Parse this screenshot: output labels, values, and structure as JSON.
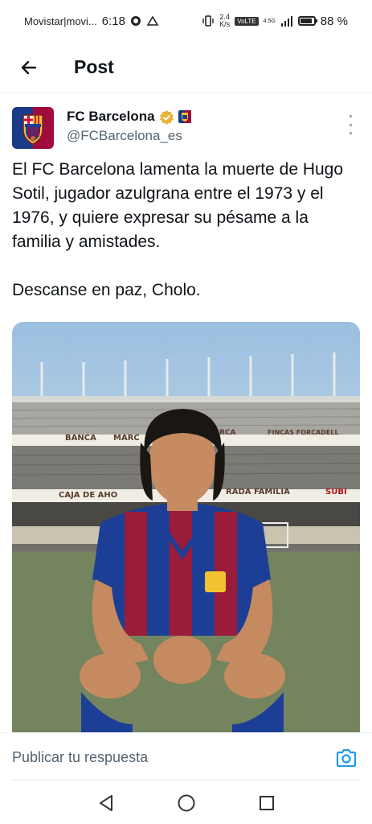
{
  "status_bar": {
    "carrier": "Movistar|movi...",
    "time": "6:18",
    "speed_value": "2.4",
    "speed_unit": "K/s",
    "volte": "VoLTE",
    "network": "4.5G",
    "battery_percent": "88 %",
    "battery_level": 0.88
  },
  "header": {
    "title": "Post"
  },
  "post": {
    "author_name": "FC Barcelona",
    "author_handle": "@FCBarcelona_es",
    "verified_color": "#e8b339",
    "text": "El FC Barcelona lamenta la muerte de Hugo Sotil, jugador azulgrana entre el 1973 y el 1976, y quiere expresar su pésame a la familia y amistades.\n\nDescanse en paz, Cholo.",
    "photo": {
      "banners": [
        "BANCA",
        "MARC",
        "RCA",
        "FINCAS FORCADELL",
        "CAJA DE AHO",
        "RADA FAMILIA",
        "SUBI"
      ]
    }
  },
  "reply": {
    "placeholder": "Publicar tu respuesta"
  },
  "colors": {
    "accent": "#1d9bf0",
    "text": "#0f1419",
    "secondary": "#536471",
    "blaugrana_blue": "#1a3a8a",
    "blaugrana_red": "#a00a3c"
  },
  "nav": {
    "back_icon": "triangle-back-icon",
    "home_icon": "circle-home-icon",
    "recents_icon": "square-recents-icon"
  }
}
